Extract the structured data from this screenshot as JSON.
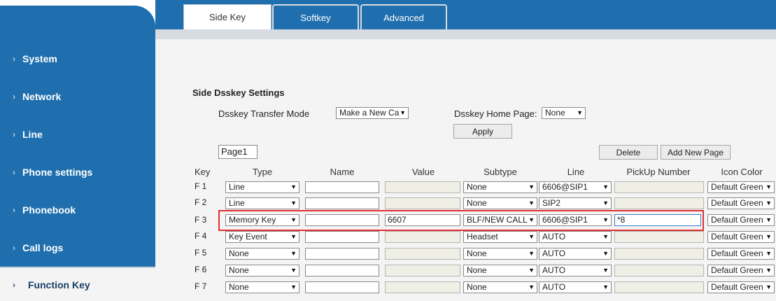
{
  "sidebar": {
    "items": [
      {
        "label": "System"
      },
      {
        "label": "Network"
      },
      {
        "label": "Line"
      },
      {
        "label": "Phone settings"
      },
      {
        "label": "Phonebook"
      },
      {
        "label": "Call logs"
      },
      {
        "label": "Function Key",
        "active": true
      }
    ]
  },
  "tabs": [
    {
      "label": "Side Key",
      "active": true
    },
    {
      "label": "Softkey"
    },
    {
      "label": "Advanced"
    }
  ],
  "section": {
    "title": "Side Dsskey Settings",
    "transfer_mode_label": "Dsskey Transfer Mode",
    "transfer_mode_value": "Make a New Ca",
    "home_page_label": "Dsskey Home Page:",
    "home_page_value": "None",
    "apply_label": "Apply"
  },
  "page_bar": {
    "page_label": "Page1",
    "delete_label": "Delete",
    "add_label": "Add New Page"
  },
  "table": {
    "headers": [
      "Key",
      "Type",
      "Name",
      "Value",
      "Subtype",
      "Line",
      "PickUp Number",
      "Icon Color"
    ],
    "rows": [
      {
        "key": "F 1",
        "type": "Line",
        "name": "",
        "value": "",
        "subtype": "None",
        "line": "6606@SIP1",
        "pickup": "",
        "icon_color": "Default Green"
      },
      {
        "key": "F 2",
        "type": "Line",
        "name": "",
        "value": "",
        "subtype": "None",
        "line": "SIP2",
        "pickup": "",
        "icon_color": "Default Green"
      },
      {
        "key": "F 3",
        "type": "Memory Key",
        "name": "",
        "value": "6607",
        "subtype": "BLF/NEW CALL",
        "line": "6606@SIP1",
        "pickup": "*8",
        "icon_color": "Default Green"
      },
      {
        "key": "F 4",
        "type": "Key Event",
        "name": "",
        "value": "",
        "subtype": "Headset",
        "line": "AUTO",
        "pickup": "",
        "icon_color": "Default Green"
      },
      {
        "key": "F 5",
        "type": "None",
        "name": "",
        "value": "",
        "subtype": "None",
        "line": "AUTO",
        "pickup": "",
        "icon_color": "Default Green"
      },
      {
        "key": "F 6",
        "type": "None",
        "name": "",
        "value": "",
        "subtype": "None",
        "line": "AUTO",
        "pickup": "",
        "icon_color": "Default Green"
      },
      {
        "key": "F 7",
        "type": "None",
        "name": "",
        "value": "",
        "subtype": "None",
        "line": "AUTO",
        "pickup": "",
        "icon_color": "Default Green"
      }
    ]
  },
  "colors": {
    "sidebar_bg": "#1f6fae",
    "content_bg": "#f4f4f4",
    "highlight": "#e03030"
  }
}
